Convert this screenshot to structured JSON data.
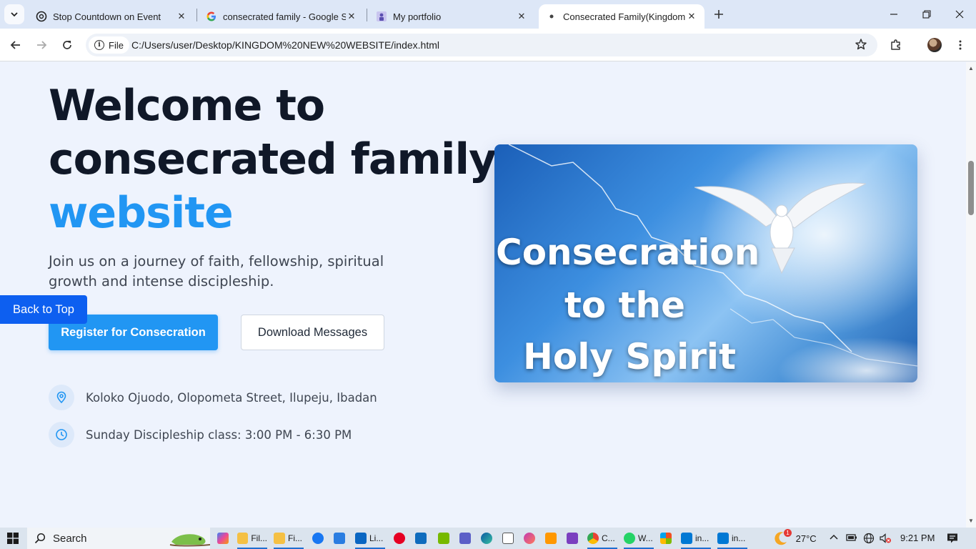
{
  "browser": {
    "tabs": [
      {
        "title": "Stop Countdown on Event",
        "icon": "openai-icon",
        "active": false
      },
      {
        "title": "consecrated family - Google Se",
        "icon": "google-icon",
        "active": false
      },
      {
        "title": "My portfolio",
        "icon": "portfolio-icon",
        "active": false
      },
      {
        "title": "Consecrated Family(KingdomPe",
        "icon": "globe-icon",
        "active": true
      }
    ],
    "address": {
      "chip_label": "File",
      "url": "C:/Users/user/Desktop/KINGDOM%20NEW%20WEBSITE/index.html"
    }
  },
  "page": {
    "title_line1": "Welcome to",
    "title_line2": "consecrated family",
    "title_accent": "website",
    "subtitle": "Join us on a journey of faith, fellowship, spiritual growth and intense discipleship.",
    "primary_button": "Register for Consecration",
    "secondary_button": "Download Messages",
    "back_to_top": "Back to Top",
    "location": "Koloko Ojuodo, Olopometa Street, Ilupeju, Ibadan",
    "schedule": "Sunday Discipleship class: 3:00 PM - 6:30 PM",
    "image_caption": [
      "Consecration",
      "to the",
      "Holy Spirit"
    ],
    "accent_color": "#2196f3"
  },
  "taskbar": {
    "search_label": "Search",
    "apps": [
      {
        "label": "Fil...",
        "icon": "file-explorer-icon"
      },
      {
        "label": "Fi...",
        "icon": "file-explorer-icon"
      },
      {
        "label": "Li...",
        "icon": "linkedin-icon"
      },
      {
        "label": "C...",
        "icon": "chrome-icon"
      },
      {
        "label": "W...",
        "icon": "whatsapp-icon"
      },
      {
        "label": "in...",
        "icon": "vscode-icon"
      },
      {
        "label": "in...",
        "icon": "vscode-icon"
      }
    ],
    "weather": "27°C",
    "weather_badge": "1",
    "time": "9:21 PM"
  }
}
